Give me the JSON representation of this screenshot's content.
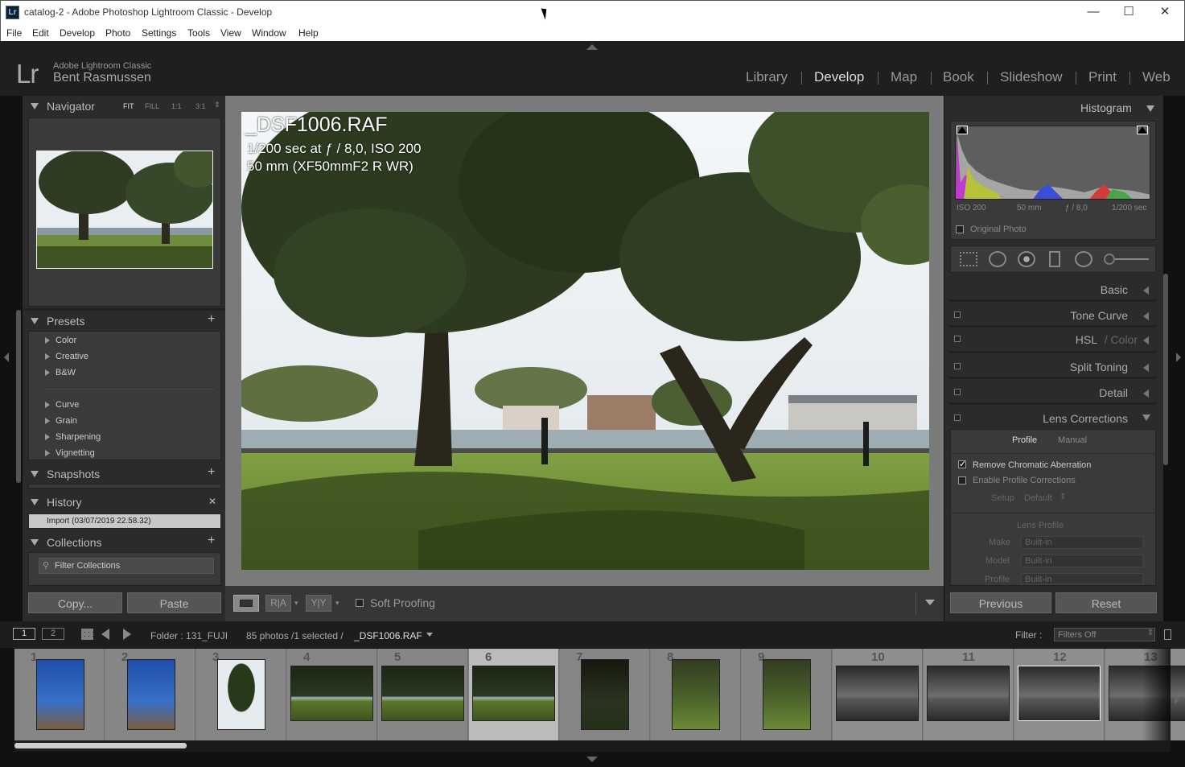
{
  "window": {
    "title": "catalog-2 - Adobe Photoshop Lightroom Classic - Develop",
    "icon": "Lr",
    "minimize": "—",
    "maximize": "☐",
    "close": "✕"
  },
  "menu": [
    "File",
    "Edit",
    "Develop",
    "Photo",
    "Settings",
    "Tools",
    "View",
    "Window",
    "Help"
  ],
  "identity": {
    "logo": "Lr",
    "product": "Adobe Lightroom Classic",
    "user": "Bent Rasmussen"
  },
  "modules": [
    "Library",
    "Develop",
    "Map",
    "Book",
    "Slideshow",
    "Print",
    "Web"
  ],
  "active_module": "Develop",
  "navigator": {
    "title": "Navigator",
    "options": [
      "FIT",
      "FILL",
      "1:1",
      "3:1"
    ]
  },
  "presets": {
    "title": "Presets",
    "groups": [
      "Color",
      "Creative",
      "B&W",
      "Curve",
      "Grain",
      "Sharpening",
      "Vignetting"
    ]
  },
  "snapshots": {
    "title": "Snapshots"
  },
  "history": {
    "title": "History",
    "close": "✕",
    "items": [
      "Import (03/07/2019 22.58.32)"
    ]
  },
  "collections": {
    "title": "Collections",
    "filter_placeholder": "Filter Collections"
  },
  "left_buttons": {
    "copy": "Copy...",
    "paste": "Paste"
  },
  "photo_info": {
    "filename": "_DSF1006.RAF",
    "exposure": "1/200 sec at ƒ / 8,0, ISO 200",
    "lens": "50 mm (XF50mmF2 R WR)"
  },
  "toolbar": {
    "soft_proofing": "Soft Proofing",
    "ra": "R|A",
    "yy": "Y|Y"
  },
  "histogram": {
    "title": "Histogram",
    "iso": "ISO 200",
    "focal": "50 mm",
    "aperture": "ƒ / 8,0",
    "shutter": "1/200 sec",
    "original_photo": "Original Photo"
  },
  "panels": {
    "basic": "Basic",
    "tone_curve": "Tone Curve",
    "hsl_a": "HSL",
    "hsl_b": "/ Color",
    "split_toning": "Split Toning",
    "detail": "Detail",
    "lens_corrections": "Lens Corrections"
  },
  "lens": {
    "tabs": [
      "Profile",
      "Manual"
    ],
    "active_tab": "Profile",
    "remove_ca": "Remove Chromatic Aberration",
    "remove_ca_checked": true,
    "enable_profile": "Enable Profile Corrections",
    "setup_label": "Setup",
    "setup_value": "Default",
    "lens_profile": "Lens Profile",
    "make_label": "Make",
    "make_value": "Built-in",
    "model_label": "Model",
    "model_value": "Built-in",
    "profile_label": "Profile",
    "profile_value": "Built-in"
  },
  "right_buttons": {
    "previous": "Previous",
    "reset": "Reset"
  },
  "filmbar": {
    "screen1": "1",
    "screen2": "2",
    "folder": "Folder : 131_FUJI",
    "count": "85 photos /1 selected /",
    "selected_file": "_DSF1006.RAF",
    "filter_label": "Filter :",
    "filter_value": "Filters Off"
  },
  "filmstrip": {
    "cells": [
      {
        "num": "1",
        "kind": "church"
      },
      {
        "num": "2",
        "kind": "church"
      },
      {
        "num": "3",
        "kind": "tree"
      },
      {
        "num": "4",
        "kind": "park"
      },
      {
        "num": "5",
        "kind": "park"
      },
      {
        "num": "6",
        "kind": "park"
      },
      {
        "num": "7",
        "kind": "dark"
      },
      {
        "num": "8",
        "kind": "grass"
      },
      {
        "num": "9",
        "kind": "grass"
      },
      {
        "num": "10",
        "kind": "sea"
      },
      {
        "num": "11",
        "kind": "sea"
      },
      {
        "num": "12",
        "kind": "sea"
      },
      {
        "num": "13",
        "kind": "sea"
      }
    ],
    "selected_index": 5
  },
  "colors": {
    "accent_active": "#dddddd",
    "panel_bg": "#2b2b2b",
    "center_bg": "#7a7a7a"
  }
}
